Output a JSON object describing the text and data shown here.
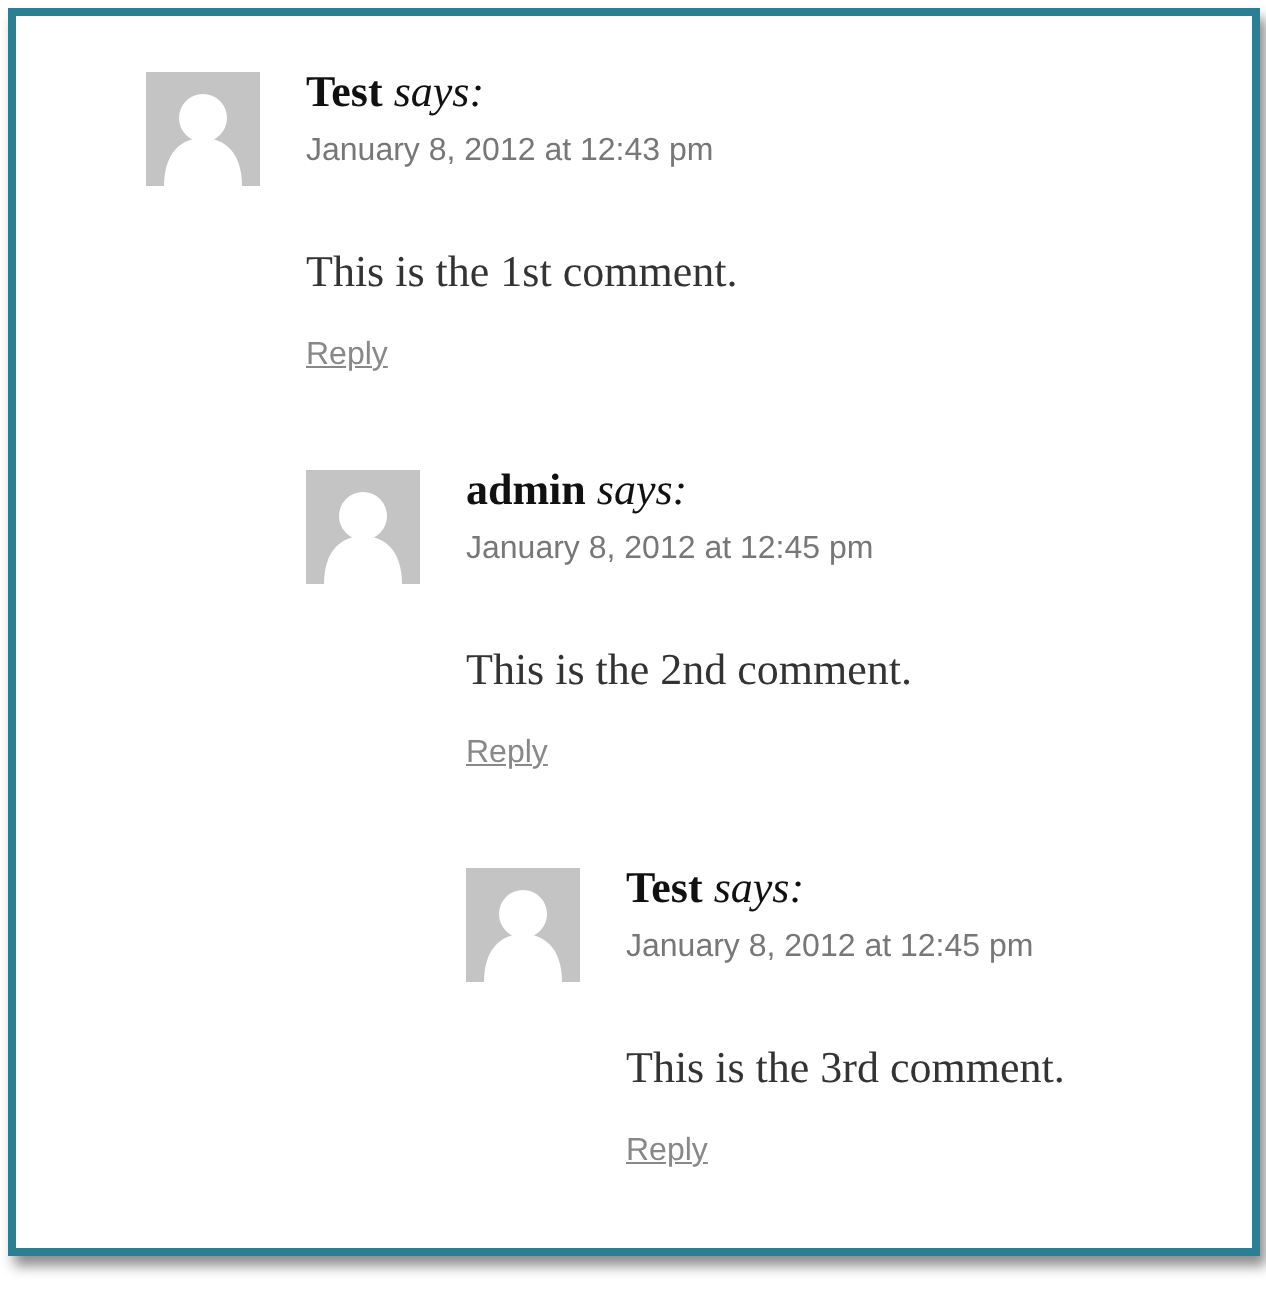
{
  "comments": [
    {
      "author": "Test",
      "says": "says:",
      "date": "January 8, 2012 at 12:43 pm",
      "text": "This is the 1st comment.",
      "reply": "Reply",
      "children": [
        {
          "author": "admin",
          "says": "says:",
          "date": "January 8, 2012 at 12:45 pm",
          "text": "This is the 2nd comment.",
          "reply": "Reply",
          "children": [
            {
              "author": "Test",
              "says": "says:",
              "date": "January 8, 2012 at 12:45 pm",
              "text": "This is the 3rd comment.",
              "reply": "Reply"
            }
          ]
        }
      ]
    }
  ]
}
